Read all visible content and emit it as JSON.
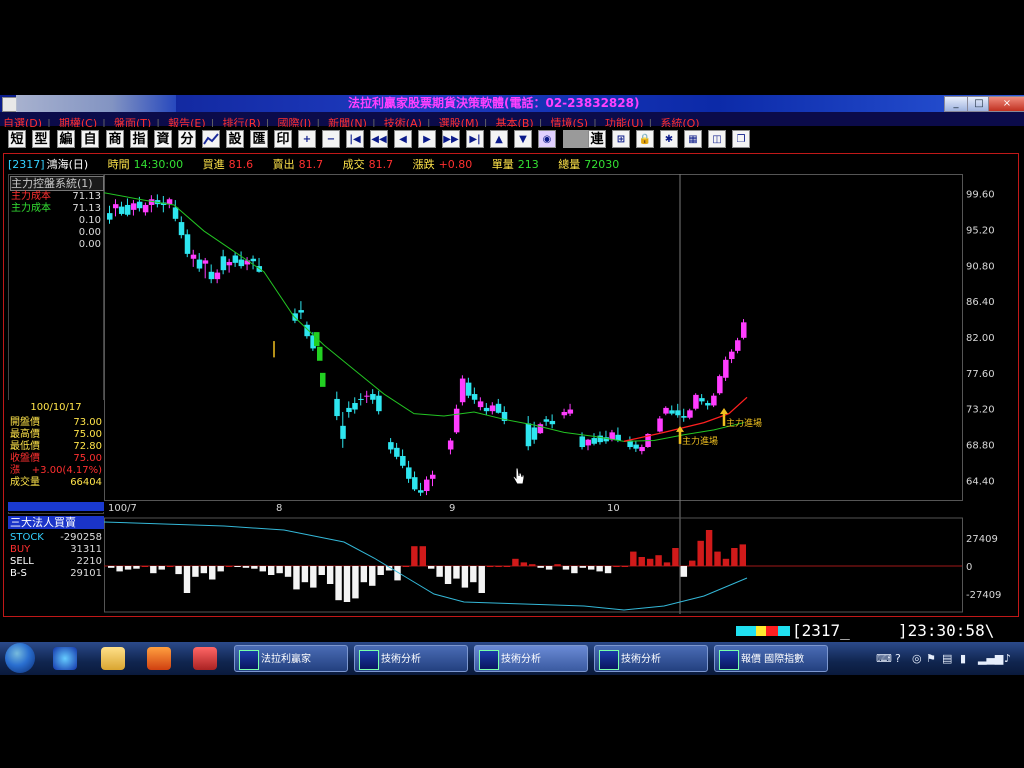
{
  "window": {
    "title": "法拉利贏家股票期貨決策軟體(電話：02-23832828)",
    "buttons": [
      "_",
      "□",
      "×"
    ]
  },
  "menu": [
    {
      "label": "自選(D)"
    },
    {
      "label": "期權(C)"
    },
    {
      "label": "盤面(T)"
    },
    {
      "label": "報告(E)"
    },
    {
      "label": "排行(R)"
    },
    {
      "label": "國際(I)"
    },
    {
      "label": "新聞(N)"
    },
    {
      "label": "技術(A)"
    },
    {
      "label": "選股(M)"
    },
    {
      "label": "基本(B)"
    },
    {
      "label": "情境(S)"
    },
    {
      "label": "功能(U)"
    },
    {
      "label": "系統(O)"
    }
  ],
  "toolbar": {
    "text_buttons": [
      "短",
      "型",
      "編",
      "自",
      "商",
      "指",
      "資",
      "分"
    ],
    "text_buttons2": [
      "設",
      "匯",
      "印"
    ],
    "link_button": "連"
  },
  "quote": {
    "code": "[2317]",
    "name": "鴻海(日)",
    "time_label": "時間",
    "time": "14:30:00",
    "bid_label": "買進",
    "bid": "81.6",
    "ask_label": "賣出",
    "ask": "81.7",
    "trade_label": "成交",
    "trade": "81.7",
    "change_label": "漲跌",
    "change": "+0.80",
    "volume_label": "單量",
    "volume": "213",
    "total_label": "總量",
    "total": "72030"
  },
  "indicator_panel": {
    "title": "主力控盤系統(1)",
    "rows": [
      {
        "label": "主力成本",
        "value": "71.13",
        "color": "#ff3030"
      },
      {
        "label": "主力成本",
        "value": "71.13",
        "color": "#33e033"
      },
      {
        "label": "",
        "value": "0.10",
        "color": "#ddd"
      },
      {
        "label": "",
        "value": "0.00",
        "color": "#ddd"
      },
      {
        "label": "",
        "value": "0.00",
        "color": "#ddd"
      }
    ]
  },
  "ohlc": {
    "date": "100/10/17",
    "rows": [
      {
        "label": "開盤價",
        "value": "73.00",
        "lcolor": "#ffe44a",
        "vcolor": "#ffe44a"
      },
      {
        "label": "最高價",
        "value": "75.00",
        "lcolor": "#ffe44a",
        "vcolor": "#ffe44a"
      },
      {
        "label": "最低價",
        "value": "72.80",
        "lcolor": "#ffe44a",
        "vcolor": "#ffe44a"
      },
      {
        "label": "收盤價",
        "value": "75.00",
        "lcolor": "#ff3030",
        "vcolor": "#ff3030"
      },
      {
        "label": "漲",
        "value": "+3.00(4.17%)",
        "lcolor": "#ff3030",
        "vcolor": "#ff3030"
      },
      {
        "label": "成交量",
        "value": "66404",
        "lcolor": "#ffe44a",
        "vcolor": "#ffe44a"
      }
    ]
  },
  "chart_data": [
    {
      "type": "candlestick",
      "title": "主力控盤系統(1)",
      "x_ticks": [
        "100/7",
        "8",
        "9",
        "10"
      ],
      "y_ticks": [
        "99.60",
        "95.20",
        "90.80",
        "86.40",
        "82.00",
        "77.60",
        "73.20",
        "68.80",
        "64.40"
      ],
      "ylim": [
        62.0,
        102.0
      ],
      "annotations": [
        "主力進場",
        "主力進場"
      ],
      "colors": {
        "up": "#ff3dff",
        "down": "#2ee6f0",
        "ma": "#23c423",
        "cost_line": "#ff2020"
      }
    },
    {
      "type": "bar",
      "title": "三大法人買賣",
      "series": [
        {
          "name": "STOCK",
          "value": "-290258"
        },
        {
          "name": "BUY",
          "value": "31311"
        },
        {
          "name": "SELL",
          "value": "2210"
        },
        {
          "name": "B-S",
          "value": "29101"
        }
      ],
      "y_ticks": [
        "27409",
        "0",
        "-27409"
      ],
      "ylim": [
        -45000,
        45000
      ]
    }
  ],
  "status": {
    "code": "[2317_",
    "clock": "]23:30:58\\"
  },
  "taskbar": {
    "tasks": [
      "法拉利贏家",
      "技術分析",
      "技術分析",
      "技術分析",
      "報價 國際指數"
    ]
  }
}
